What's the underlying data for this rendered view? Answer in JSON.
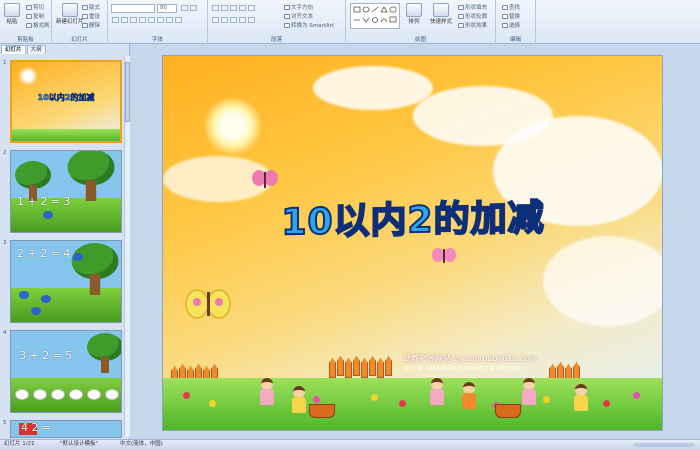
{
  "ribbon": {
    "groups": [
      {
        "label": "剪贴板",
        "items": [
          "粘贴",
          "剪切",
          "复制",
          "格式刷"
        ]
      },
      {
        "label": "幻灯片",
        "items": [
          "新建幻灯片",
          "版式",
          "重设",
          "删除"
        ]
      },
      {
        "label": "字体",
        "font_size": "80",
        "items": []
      },
      {
        "label": "段落",
        "items": [
          "文字方向",
          "对齐文本",
          "转换为 SmartArt"
        ]
      },
      {
        "label": "绘图",
        "items": [
          "排列",
          "快速样式",
          "形状填充",
          "形状轮廓",
          "形状效果"
        ]
      },
      {
        "label": "编辑",
        "items": [
          "查找",
          "替换",
          "选择"
        ]
      }
    ]
  },
  "panel": {
    "tabs": [
      "幻灯片",
      "大纲"
    ],
    "slides": [
      {
        "num": "1",
        "text": "10以内2的加减"
      },
      {
        "num": "2",
        "text": "1 + 2 = 3"
      },
      {
        "num": "3",
        "text": "2 + 2 = 4"
      },
      {
        "num": "4",
        "text": "3 + 2 = 5"
      },
      {
        "num": "5",
        "text": "4   2 ="
      }
    ]
  },
  "slide": {
    "title": "10以内2的加减",
    "site_line": "幼教资源网站 ziyuan.baby611.com",
    "site_sub": "课件下载 儿歌 故事MP3 FLASH课件下载 试卷下载站"
  },
  "status": {
    "slide_count": "幻灯片 1/21",
    "theme": "\"默认设计模板\"",
    "language": "中文(简体，中国)"
  },
  "colors": {
    "accent": "#2aa7ee",
    "selected_border": "#f0a020"
  }
}
